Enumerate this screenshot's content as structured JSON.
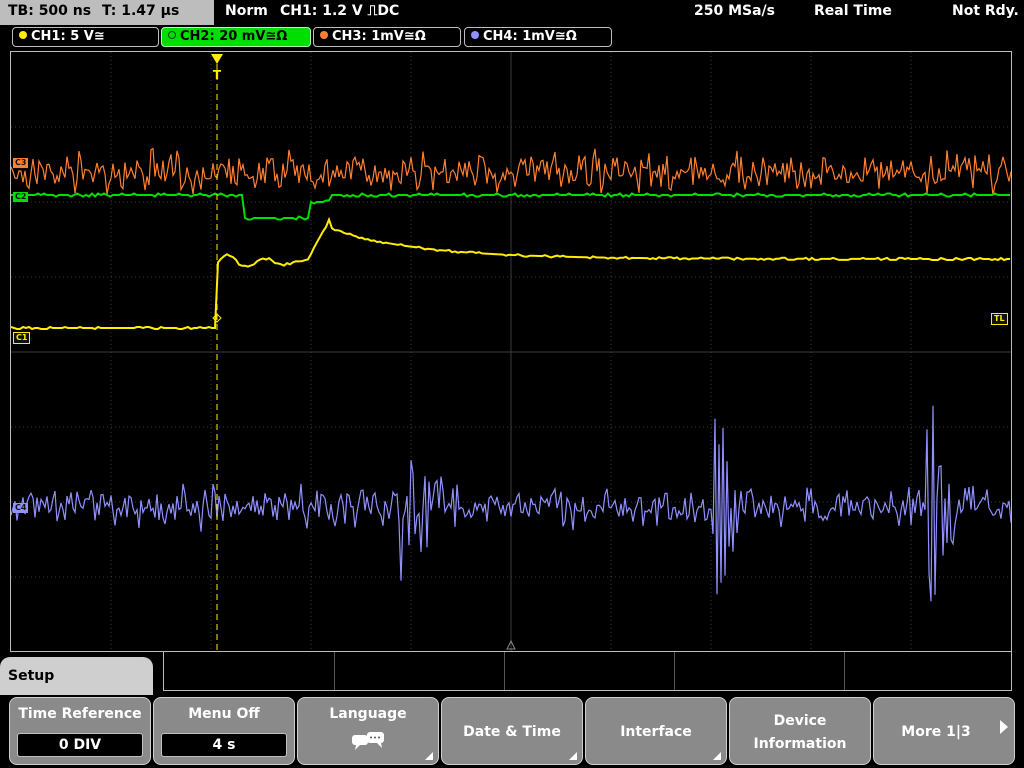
{
  "top": {
    "timebase": "TB: 500 ns",
    "trigger_time": "T: 1.47 µs",
    "mode": "Norm",
    "trigger": "CH1: 1.2 V ⎍DC",
    "sample_rate": "250 MSa/s",
    "acq_mode": "Real Time",
    "status": "Not Rdy."
  },
  "channels": [
    {
      "label": "CH1: 5 V≅",
      "color": "#ffee00"
    },
    {
      "label": "CH2: 20 mV≅Ω",
      "color": "#00dd00",
      "active": true
    },
    {
      "label": "CH3: 1mV≅Ω",
      "color": "#ff8030"
    },
    {
      "label": "CH4: 1mV≅Ω",
      "color": "#9090ff"
    }
  ],
  "markers": {
    "ch3": "C3",
    "ch2": "C2",
    "ch1": "C1",
    "ch4": "C4",
    "trigger_level": "TL"
  },
  "menu": {
    "tab_title": "Setup",
    "time_reference_label": "Time Reference",
    "time_reference_value": "0 DIV",
    "menu_off_label": "Menu Off",
    "menu_off_value": "4 s",
    "language_label": "Language",
    "date_time_label": "Date & Time",
    "interface_label": "Interface",
    "device_information_label_1": "Device",
    "device_information_label_2": "Information",
    "more_label": "More 1|3"
  },
  "colors": {
    "ch1": "#ffee00",
    "ch2": "#00dd00",
    "ch3": "#ff8030",
    "ch4": "#9090ff",
    "grid": "#3a3a3a"
  },
  "icons": [
    "trigger-marker-icon",
    "language-chat-icon",
    "more-arrow-icon"
  ]
}
